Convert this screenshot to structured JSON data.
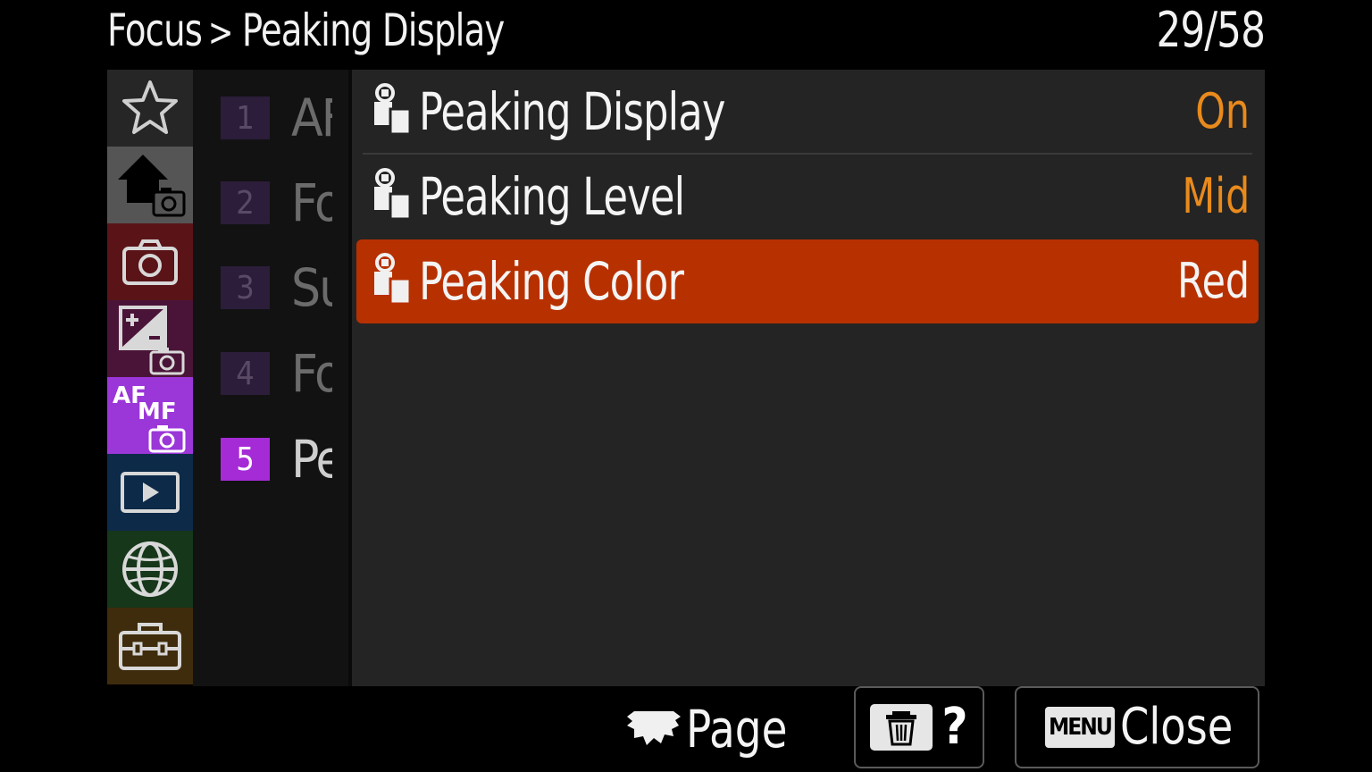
{
  "header": {
    "breadcrumb_parent": "Focus",
    "breadcrumb_separator": ">",
    "breadcrumb_current": "Peaking Display",
    "page_count": "29/58"
  },
  "rail": {
    "tabs": [
      {
        "icon": "star-icon",
        "color": "#262626"
      },
      {
        "icon": "home-camera-icon",
        "color": "#555555"
      },
      {
        "icon": "camera-icon",
        "color": "#5a1418"
      },
      {
        "icon": "exposure-camera-icon",
        "color": "#4a1438"
      },
      {
        "icon": "af-mf-camera-icon",
        "color": "#9b36d8",
        "af": "AF",
        "mf": "MF"
      },
      {
        "icon": "playback-icon",
        "color": "#0d2a48"
      },
      {
        "icon": "globe-icon",
        "color": "#16371a"
      },
      {
        "icon": "toolbox-icon",
        "color": "#3f2c0c"
      }
    ]
  },
  "subpages": [
    {
      "number": "1",
      "label": "AF"
    },
    {
      "number": "2",
      "label": "Fo"
    },
    {
      "number": "3",
      "label": "Su"
    },
    {
      "number": "4",
      "label": "Fo"
    },
    {
      "number": "5",
      "label": "Pe",
      "active": true
    }
  ],
  "items": [
    {
      "label": "Peaking Display",
      "value": "On"
    },
    {
      "label": "Peaking Level",
      "value": "Mid"
    },
    {
      "label": "Peaking Color",
      "value": "Red",
      "selected": true
    }
  ],
  "footer": {
    "page_label": "Page",
    "help_label": "?",
    "menu_key": "MENU",
    "close_label": "Close"
  },
  "colors": {
    "selection": "#b73000",
    "value_text": "#e98a1c",
    "active_subpage": "#a52bd6"
  }
}
